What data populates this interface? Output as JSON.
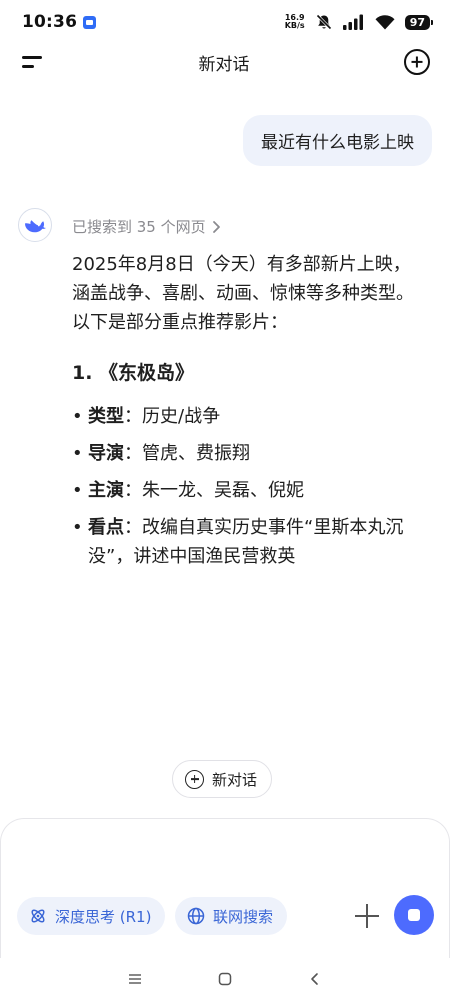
{
  "status_bar": {
    "time": "10:36",
    "net_speed_value": "16.9",
    "net_speed_unit": "KB/s",
    "battery": "97",
    "icons": [
      "app-notification-icon",
      "mute-bell-icon",
      "signal-icon",
      "wifi-icon",
      "battery-icon"
    ]
  },
  "header": {
    "title": "新对话"
  },
  "user_message": {
    "text": "最近有什么电影上映"
  },
  "assistant": {
    "search_summary": "已搜索到 35 个网页",
    "intro": "2025年8月8日（今天）有多部新片上映，涵盖战争、喜剧、动画、惊悚等多种类型。以下是部分重点推荐影片：",
    "section_title": "1. 《东极岛》",
    "items": [
      {
        "label": "类型",
        "value": "：历史/战争"
      },
      {
        "label": "导演",
        "value": "：管虎、费振翔"
      },
      {
        "label": "主演",
        "value": "：朱一龙、吴磊、倪妮"
      },
      {
        "label": "看点",
        "value": "：改编自真实历史事件“里斯本丸沉没”，讲述中国渔民营救英"
      }
    ]
  },
  "new_chat_pill": {
    "label": "新对话"
  },
  "composer": {
    "input_value": "",
    "deep_think_label": "深度思考 (R1)",
    "web_search_label": "联网搜索"
  },
  "colors": {
    "accent": "#4d6bfe",
    "chip_bg": "#eef2fb",
    "chip_text": "#3a66d6",
    "user_bubble_bg": "#eef2fb",
    "muted_text": "#8a8a8f"
  }
}
